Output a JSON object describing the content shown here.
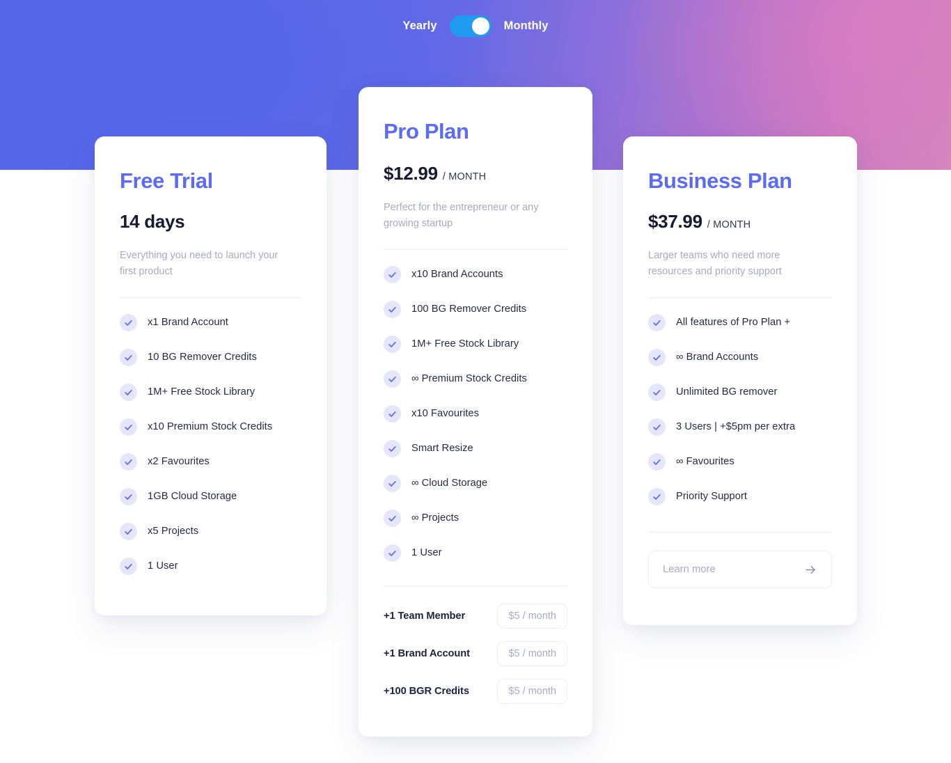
{
  "billing_toggle": {
    "left_label": "Yearly",
    "right_label": "Monthly",
    "selected": "Monthly",
    "switch_color": "#1f9bef",
    "knob_color": "#ffffff"
  },
  "theme": {
    "accent": "#5c6cf2",
    "heading": "#171a32",
    "muted": "#a8abbd",
    "check_badge_bg": "#e6e6fb",
    "gradient_start": "#5766e8",
    "gradient_end": "#d486bd"
  },
  "plans": [
    {
      "id": "free-trial",
      "title": "Free Trial",
      "price": "14 days",
      "period": "",
      "description": "Everything you need to launch your first product",
      "features": [
        "x1 Brand Account",
        "10 BG Remover Credits",
        "1M+ Free Stock Library",
        "x10 Premium Stock Credits",
        "x2 Favourites",
        "1GB Cloud Storage",
        "x5 Projects",
        "1 User"
      ]
    },
    {
      "id": "pro-plan",
      "title": "Pro Plan",
      "price": "$12.99",
      "period": "/ MONTH",
      "description": "Perfect for the entrepreneur or any growing startup",
      "features": [
        "x10 Brand Accounts",
        "100 BG Remover Credits",
        "1M+ Free Stock Library",
        "∞ Premium Stock Credits",
        "x10 Favourites",
        "Smart Resize",
        "∞ Cloud Storage",
        "∞ Projects",
        "1 User"
      ],
      "addons": [
        {
          "label": "+1 Team Member",
          "price": "$5 / month"
        },
        {
          "label": "+1 Brand Account",
          "price": "$5 / month"
        },
        {
          "label": "+100 BGR Credits",
          "price": "$5 / month"
        }
      ]
    },
    {
      "id": "business-plan",
      "title": "Business Plan",
      "price": "$37.99",
      "period": "/ MONTH",
      "description": "Larger teams who need more resources and priority support",
      "features": [
        "All features of Pro Plan +",
        "∞ Brand Accounts",
        "Unlimited BG remover",
        "3 Users | +$5pm per extra",
        "∞ Favourites",
        "Priority Support"
      ],
      "cta": {
        "label": "Learn more",
        "icon": "arrow-right-icon"
      }
    }
  ]
}
